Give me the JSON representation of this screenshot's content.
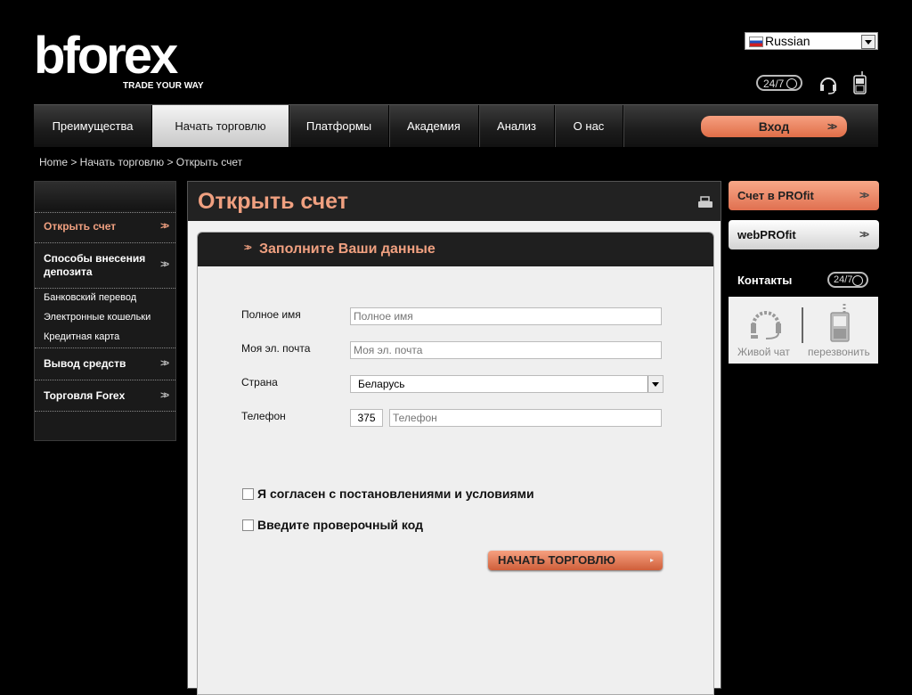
{
  "header": {
    "logo_text": "bforex",
    "logo_tagline": "TRADE YOUR WAY",
    "language": "Russian",
    "icon_247": "24/7"
  },
  "nav": {
    "items": [
      {
        "label": "Преимущества"
      },
      {
        "label": "Начать торговлю"
      },
      {
        "label": "Платформы"
      },
      {
        "label": "Академия"
      },
      {
        "label": "Анализ"
      },
      {
        "label": "О нас"
      }
    ],
    "login_label": "Вход"
  },
  "breadcrumb": "Home > Начать торговлю > Открыть счет",
  "sidebar": {
    "items": [
      {
        "label": "Открыть счет"
      },
      {
        "label": "Способы внесения депозита"
      },
      {
        "label": "Банковский перевод"
      },
      {
        "label": "Электронные кошельки"
      },
      {
        "label": "Кредитная карта"
      },
      {
        "label": "Вывод средств"
      },
      {
        "label": "Торговля Forex"
      }
    ]
  },
  "main": {
    "title": "Открыть счет",
    "form_title": "Заполните Ваши данные",
    "fields": {
      "full_name": {
        "label": "Полное имя",
        "placeholder": "Полное имя"
      },
      "email": {
        "label": "Моя эл. почта",
        "placeholder": "Моя эл. почта"
      },
      "country": {
        "label": "Страна",
        "value": "Беларусь"
      },
      "phone": {
        "label": "Телефон",
        "code": "375",
        "placeholder": "Телефон"
      }
    },
    "agree_label": "Я согласен с постановлениями и условиями",
    "captcha_label": "Введите проверочный код",
    "submit_label": "НАЧАТЬ ТОРГОВЛЮ"
  },
  "right": {
    "profit_label": "Счет в PROfit",
    "web_label": "webPROfit",
    "contacts_title": "Контакты",
    "contacts_247": "24/7",
    "live_chat": "Живой чат",
    "callback": "перезвонить"
  },
  "colors": {
    "accent": "#f0a080",
    "button": "#e06e48",
    "background": "#000000"
  }
}
